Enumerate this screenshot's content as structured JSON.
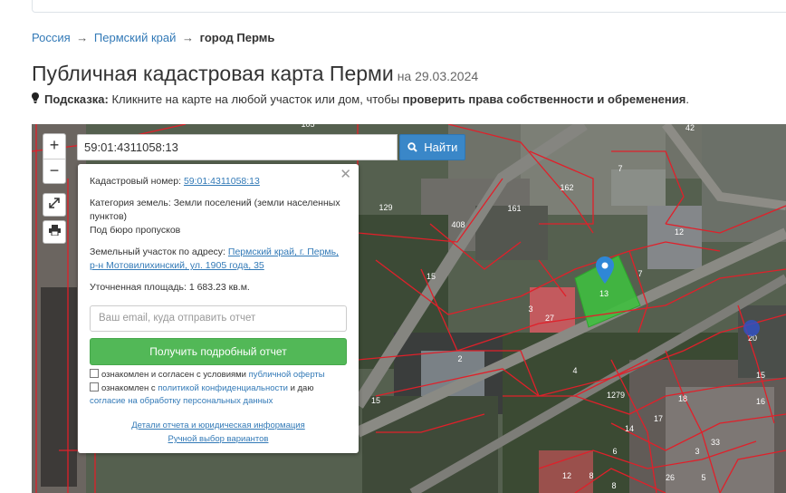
{
  "breadcrumb": {
    "items": [
      "Россия",
      "Пермский край"
    ],
    "separator": "→",
    "current": "город Пермь"
  },
  "header": {
    "title": "Публичная кадастровая карта Перми",
    "date": "на 29.03.2024"
  },
  "hint": {
    "label": "Подсказка:",
    "text": "Кликните на карте на любой участок или дом, чтобы",
    "emphasis": "проверить права собственности и обременения",
    "end": "."
  },
  "map": {
    "zoom_in": "+",
    "zoom_out": "−",
    "search_value": "59:01:4311058:13",
    "search_button": "Найти",
    "labels": [
      "105",
      "42",
      "7",
      "129",
      "162",
      "161",
      "408",
      "12",
      "15",
      "7",
      "13",
      "3",
      "27",
      "2",
      "4",
      "20",
      "15",
      "1279",
      "18",
      "15",
      "16",
      "17",
      "14",
      "3",
      "33",
      "6",
      "8",
      "12",
      "26",
      "5",
      "8"
    ]
  },
  "popup": {
    "cadastral_label": "Кадастровый номер:",
    "cadastral_value": "59:01:4311058:13",
    "category_label": "Категория земель:",
    "category_value": "Земли поселений (земли населенных пунктов)",
    "purpose": "Под бюро пропусков",
    "address_label": "Земельный участок по адресу:",
    "address_value": "Пермский край, г. Пермь, р-н Мотовилихинский, ул. 1905 года, 35",
    "area_label": "Уточненная площадь:",
    "area_value": "1 683.23 кв.м.",
    "email_placeholder": "Ваш email, куда отправить отчет",
    "get_report_button": "Получить подробный отчет",
    "consent1_text": "ознакомлен и согласен с условиями",
    "consent1_link": "публичной оферты",
    "consent2_text": "ознакомлен с",
    "consent2_link1": "политикой конфиденциальности",
    "consent2_mid": "и даю",
    "consent2_link2": "согласие на обработку персональных данных",
    "details_link": "Детали отчета и юридическая информация",
    "manual_link": "Ручной выбор вариантов"
  },
  "colors": {
    "link": "#337ab7",
    "accent_blue": "#3a87c8",
    "green": "#52b857",
    "parcel_border": "#e0202a"
  }
}
